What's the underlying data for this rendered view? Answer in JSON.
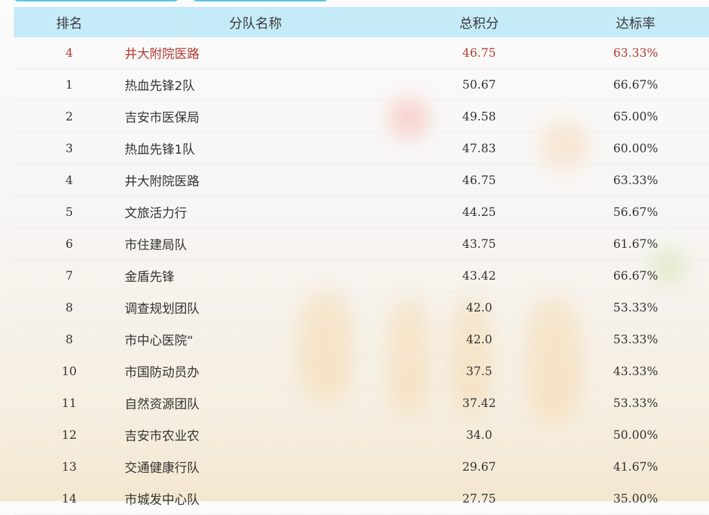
{
  "header": {
    "rank": "排名",
    "team_name": "分队名称",
    "total_score": "总积分",
    "rate": "达标率"
  },
  "highlight_row": {
    "rank": "4",
    "name": "井大附院医路",
    "score": "46.75",
    "rate": "63.33%"
  },
  "rows": [
    {
      "rank": "1",
      "name": "热血先锋2队",
      "score": "50.67",
      "rate": "66.67%"
    },
    {
      "rank": "2",
      "name": "吉安市医保局",
      "score": "49.58",
      "rate": "65.00%"
    },
    {
      "rank": "3",
      "name": "热血先锋1队",
      "score": "47.83",
      "rate": "60.00%"
    },
    {
      "rank": "4",
      "name": "井大附院医路",
      "score": "46.75",
      "rate": "63.33%"
    },
    {
      "rank": "5",
      "name": "文旅活力行",
      "score": "44.25",
      "rate": "56.67%"
    },
    {
      "rank": "6",
      "name": "市住建局队",
      "score": "43.75",
      "rate": "61.67%"
    },
    {
      "rank": "7",
      "name": "金盾先锋",
      "score": "43.42",
      "rate": "66.67%"
    },
    {
      "rank": "8",
      "name": "调查规划团队",
      "score": "42.0",
      "rate": "53.33%"
    },
    {
      "rank": "8",
      "name": "市中心医院“",
      "score": "42.0",
      "rate": "53.33%"
    },
    {
      "rank": "10",
      "name": "市国防动员办",
      "score": "37.5",
      "rate": "43.33%"
    },
    {
      "rank": "11",
      "name": "自然资源团队",
      "score": "37.42",
      "rate": "53.33%"
    },
    {
      "rank": "12",
      "name": "吉安市农业农",
      "score": "34.0",
      "rate": "50.00%"
    },
    {
      "rank": "13",
      "name": "交通健康行队",
      "score": "29.67",
      "rate": "41.67%"
    },
    {
      "rank": "14",
      "name": "市城发中心队",
      "score": "27.75",
      "rate": "35.00%"
    }
  ],
  "colors": {
    "header_bg": "#c6ebf8",
    "highlight_text": "#b43a32",
    "tab_accent": "#4fc7e0"
  }
}
